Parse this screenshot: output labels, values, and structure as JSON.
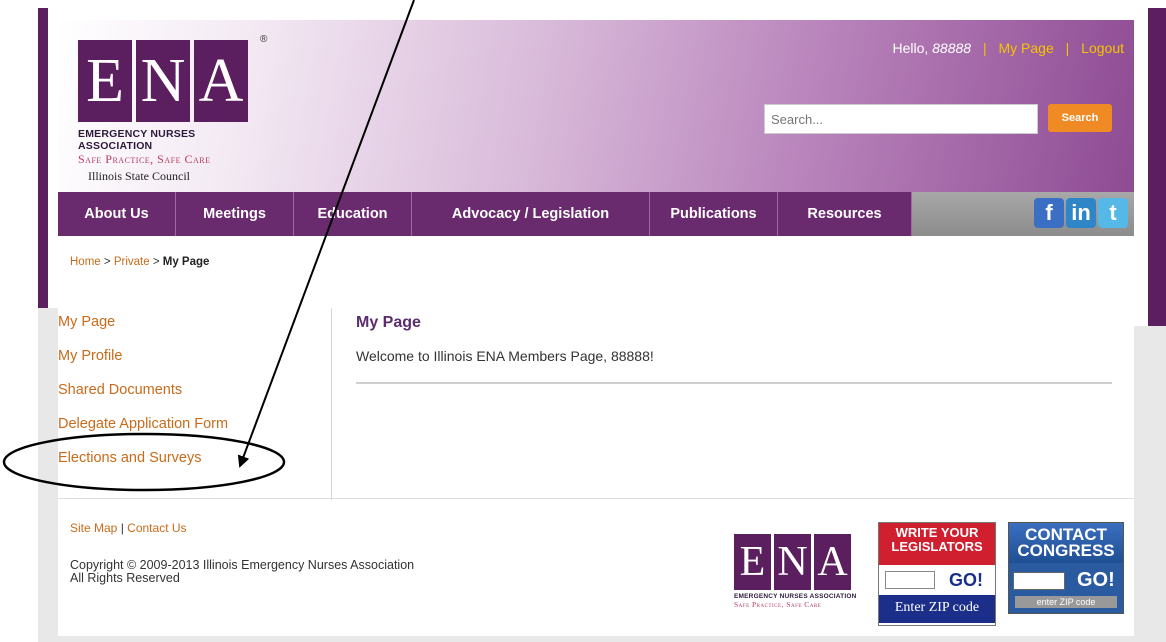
{
  "header": {
    "logo_letters": [
      "E",
      "N",
      "A"
    ],
    "logo_org": "EMERGENCY NURSES ASSOCIATION",
    "logo_tagline": "Safe Practice, Safe Care",
    "logo_council": "Illinois State Council",
    "greeting": "Hello,",
    "username": "88888",
    "my_page_label": "My Page",
    "logout_label": "Logout",
    "search_placeholder": "Search...",
    "search_button": "Search"
  },
  "nav": {
    "items": [
      {
        "label": "About Us"
      },
      {
        "label": "Meetings"
      },
      {
        "label": "Education"
      },
      {
        "label": "Advocacy / Legislation"
      },
      {
        "label": "Publications"
      },
      {
        "label": "Resources"
      }
    ],
    "social": [
      {
        "icon": "facebook-icon",
        "glyph": "f"
      },
      {
        "icon": "linkedin-icon",
        "glyph": "in"
      },
      {
        "icon": "twitter-icon",
        "glyph": "t"
      }
    ]
  },
  "breadcrumb": {
    "home": "Home",
    "private": "Private",
    "current": "My Page",
    "separator": ">"
  },
  "sidebar": {
    "items": [
      {
        "label": "My Page"
      },
      {
        "label": "My Profile"
      },
      {
        "label": "Shared Documents"
      },
      {
        "label": "Delegate Application Form"
      },
      {
        "label": "Elections and Surveys"
      }
    ]
  },
  "main": {
    "title": "My Page",
    "welcome": "Welcome to Illinois ENA Members Page, 88888!"
  },
  "footer": {
    "site_map": "Site Map",
    "contact_us": "Contact Us",
    "link_separator": "|",
    "copyright": "Copyright © 2009-2013 Illinois Emergency Nurses Association",
    "rights": "All Rights Reserved",
    "write_legislators": {
      "title_line1": "WRITE YOUR",
      "title_line2": "LEGISLATORS",
      "go": "GO!",
      "zip_label": "Enter ZIP code"
    },
    "contact_congress": {
      "title_line1": "CONTACT",
      "title_line2": "CONGRESS",
      "go": "GO!",
      "zip_label": "enter ZIP code"
    }
  },
  "colors": {
    "brand_purple": "#5b1e5f",
    "nav_purple": "#6a2a6e",
    "link_orange": "#c96b1a",
    "search_orange": "#f08a24",
    "accent_yellow": "#f5c400"
  }
}
